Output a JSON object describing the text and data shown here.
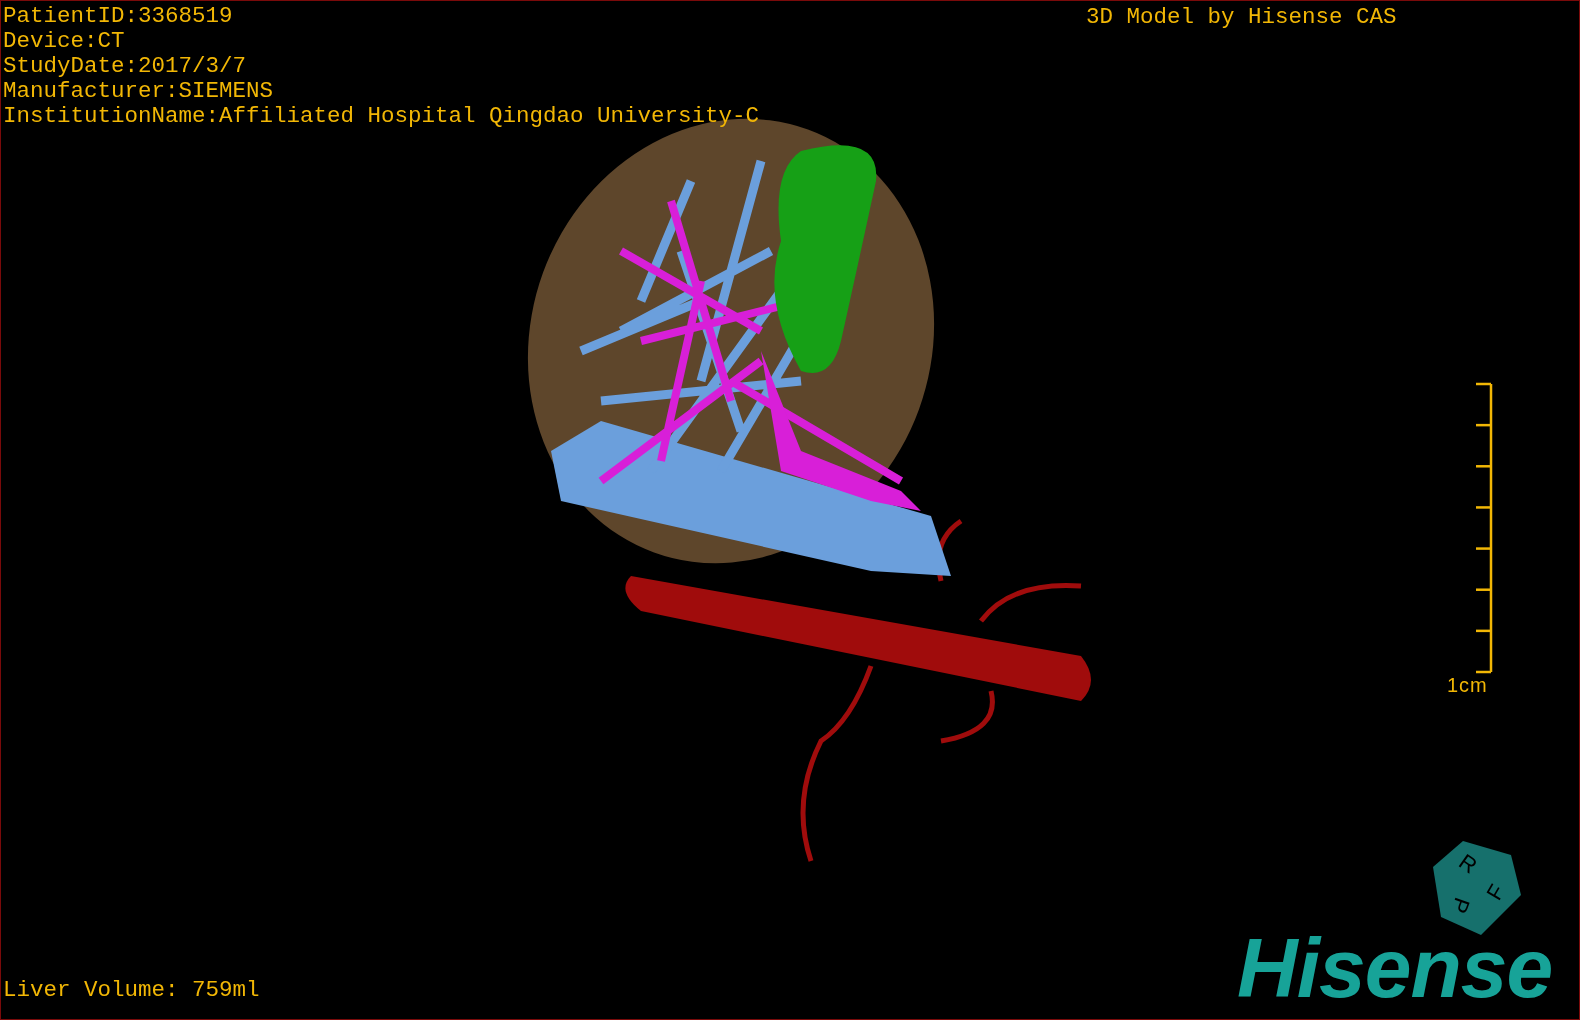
{
  "info_lines": [
    "PatientID:3368519",
    "Device:CT",
    "StudyDate:2017/3/7",
    "Manufacturer:SIEMENS",
    "InstitutionName:Affiliated Hospital Qingdao University-C"
  ],
  "title": "3D Model by Hisense CAS",
  "scale_bar": {
    "label": "1cm"
  },
  "orientation_cube": {
    "faces": [
      "R",
      "F",
      "P"
    ]
  },
  "liver_volume": "Liver Volume: 759ml",
  "brand_logo": "Hisense"
}
